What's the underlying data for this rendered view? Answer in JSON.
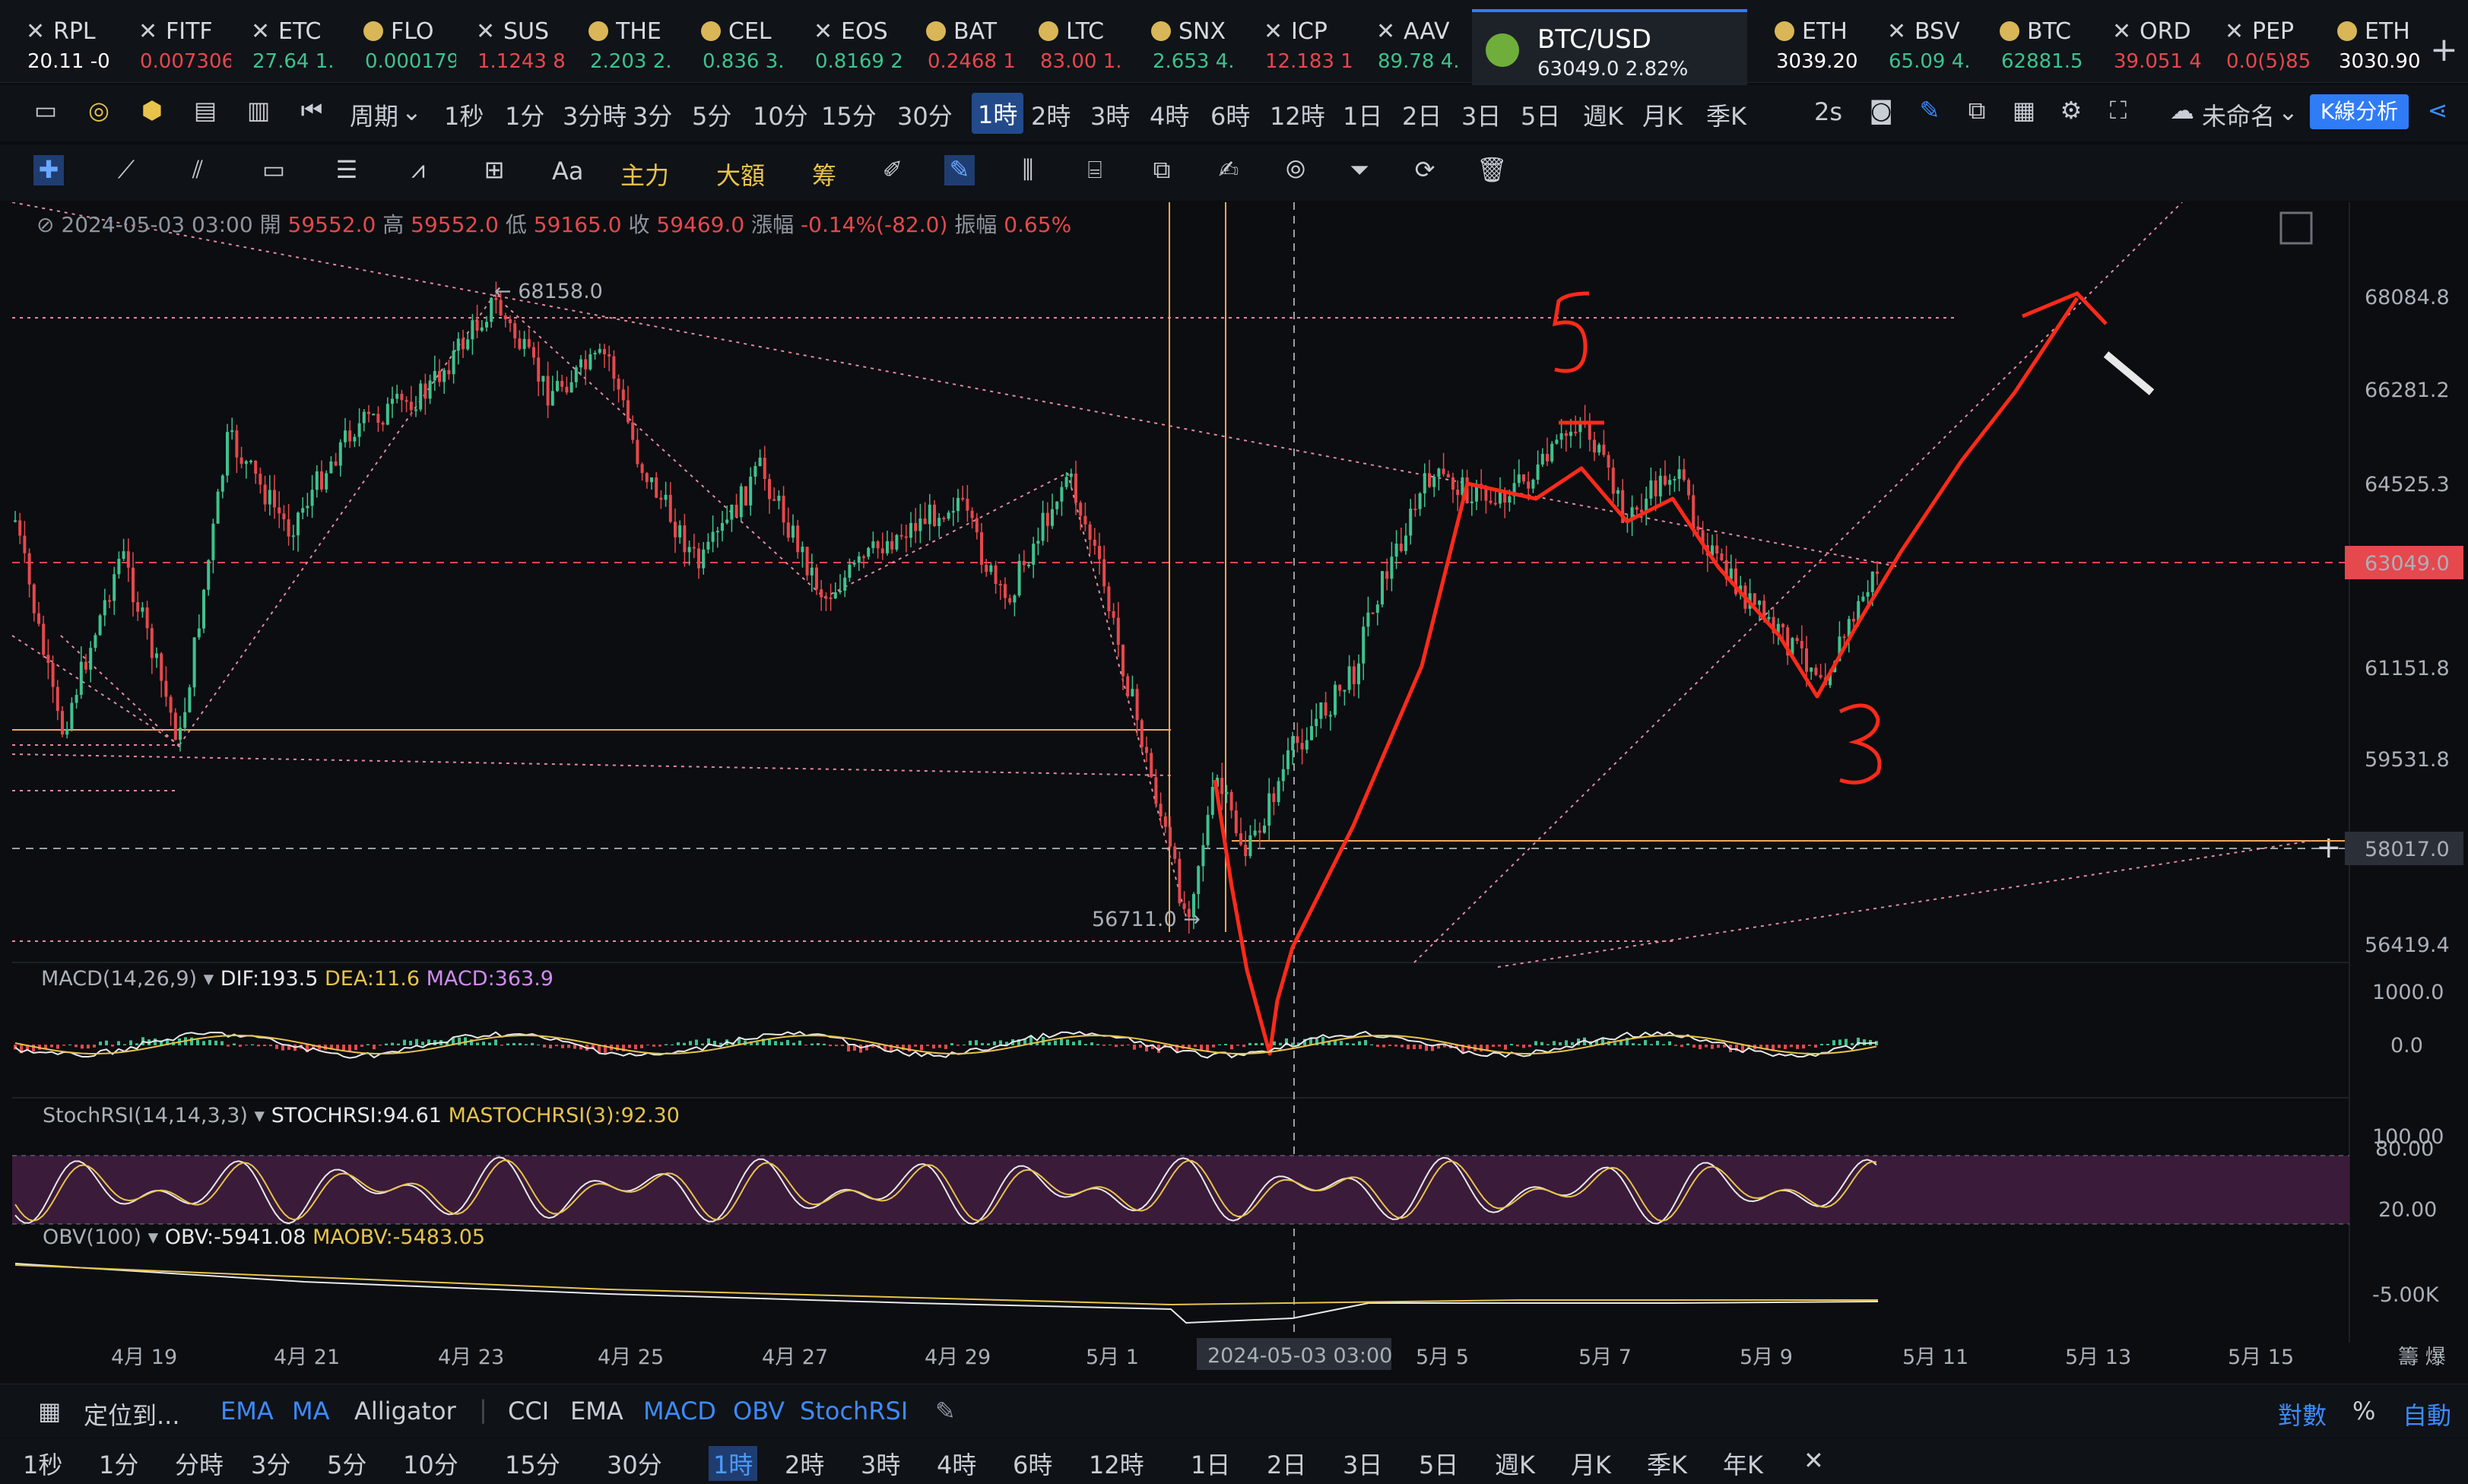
{
  "tickers": [
    {
      "name": "RPL",
      "value": "20.11 -0",
      "icon": "close-icon",
      "color": "#ffffff"
    },
    {
      "name": "FITF",
      "value": "0.007306",
      "icon": "close-icon",
      "color": "#e5484d"
    },
    {
      "name": "ETC",
      "value": "27.64 1.",
      "icon": "close-icon",
      "color": "#3ec28f"
    },
    {
      "name": "FLO",
      "value": "0.000179",
      "icon": "coin-icon",
      "color": "#3ec28f"
    },
    {
      "name": "SUS",
      "value": "1.1243 8",
      "icon": "close-icon",
      "color": "#e5484d"
    },
    {
      "name": "THE",
      "value": "2.203 2.",
      "icon": "coin-icon",
      "color": "#3ec28f"
    },
    {
      "name": "CEL",
      "value": "0.836 3.",
      "icon": "coin-icon",
      "color": "#3ec28f"
    },
    {
      "name": "EOS",
      "value": "0.8169 2",
      "icon": "close-icon",
      "color": "#3ec28f"
    },
    {
      "name": "BAT",
      "value": "0.2468 1",
      "icon": "coin-icon",
      "color": "#e5484d"
    },
    {
      "name": "LTC",
      "value": "83.00 1.",
      "icon": "coin-icon",
      "color": "#e5484d"
    },
    {
      "name": "SNX",
      "value": "2.653 4.",
      "icon": "coin-icon",
      "color": "#3ec28f"
    },
    {
      "name": "ICP",
      "value": "12.183 1",
      "icon": "close-icon",
      "color": "#e5484d"
    },
    {
      "name": "AAV",
      "value": "89.78 4.",
      "icon": "close-icon",
      "color": "#3ec28f"
    }
  ],
  "active_tab": {
    "name": "BTC/USD",
    "value": "63049.0  2.82%"
  },
  "tickers_right": [
    {
      "name": "ETH",
      "value": "3039.20",
      "icon": "coin-icon",
      "color": "#ffffff"
    },
    {
      "name": "BSV",
      "value": "65.09 4.",
      "icon": "close-icon",
      "color": "#3ec28f"
    },
    {
      "name": "BTC",
      "value": "62881.5",
      "icon": "coin-icon",
      "color": "#3ec28f"
    },
    {
      "name": "ORD",
      "value": "39.051 4",
      "icon": "close-icon",
      "color": "#e5484d"
    },
    {
      "name": "PEP",
      "value": "0.0(5)85",
      "icon": "close-icon",
      "color": "#e5484d"
    },
    {
      "name": "ETH",
      "value": "3030.90",
      "icon": "coin-icon",
      "color": "#ffffff"
    }
  ],
  "toolbar": {
    "period_label": "周期",
    "timeframes": [
      "1秒",
      "1分",
      "3分時",
      "3分",
      "5分",
      "10分",
      "15分",
      "30分",
      "1時",
      "2時",
      "3時",
      "4時",
      "6時",
      "12時",
      "1日",
      "2日",
      "3日",
      "5日",
      "週K",
      "月K",
      "季K"
    ],
    "active_timeframe": "1時",
    "refresh": "2s",
    "layout_name": "未命名",
    "kline_button": "K線分析"
  },
  "drawing_tools": {
    "text_tool": "Aa",
    "main_force": "主力",
    "big_amount": "大額",
    "chips": "筹"
  },
  "ohlc": {
    "date": "2024-05-03 03:00",
    "open_label": "開",
    "open": "59552.0",
    "high_label": "高",
    "high": "59552.0",
    "low_label": "低",
    "low": "59165.0",
    "close_label": "收",
    "close": "59469.0",
    "change_label": "漲幅",
    "change": "-0.14%(-82.0)",
    "amp_label": "振幅",
    "amp": "0.65%"
  },
  "price_axis": [
    "68084.8",
    "66281.2",
    "64525.3",
    "61151.8",
    "59531.8",
    "56419.4"
  ],
  "current_price": "63049.0",
  "crosshair_price": "58017.0",
  "price_annotations": {
    "high": "68158.0",
    "low": "56711.0"
  },
  "handwriting": {
    "wave5": "5",
    "wave3": "3"
  },
  "macd": {
    "name": "MACD(14,26,9)",
    "dif_label": "DIF:193.5",
    "dea_label": "DEA:11.6",
    "macd_label": "MACD:363.9",
    "axis": [
      "1000.0",
      "0.0"
    ]
  },
  "stochrsi": {
    "name": "StochRSI(14,14,3,3)",
    "k_label": "STOCHRSI:94.61",
    "d_label": "MASTOCHRSI(3):92.30",
    "axis": [
      "100.00",
      "80.00",
      "20.00"
    ]
  },
  "obv": {
    "name": "OBV(100)",
    "obv_label": "OBV:-5941.08",
    "ma_label": "MAOBV:-5483.05",
    "axis": [
      "-5.00K"
    ]
  },
  "date_axis": [
    "4月 19",
    "4月 21",
    "4月 23",
    "4月 25",
    "4月 27",
    "4月 29",
    "5月 1",
    "5月 5",
    "5月 7",
    "5月 9",
    "5月 11",
    "5月 13",
    "5月 15"
  ],
  "crosshair_date": "2024-05-03 03:00",
  "date_axis_right": "籌 爆",
  "bottom_indicators": {
    "locate": "定位到...",
    "items": [
      "EMA",
      "MA",
      "Alligator",
      "CCI",
      "EMA",
      "MACD",
      "OBV",
      "StochRSI"
    ],
    "scale": [
      "對數",
      "%",
      "自動"
    ]
  },
  "bottom_timeframes": [
    "1秒",
    "1分",
    "分時",
    "3分",
    "5分",
    "10分",
    "15分",
    "30分",
    "1時",
    "2時",
    "3時",
    "4時",
    "6時",
    "12時",
    "1日",
    "2日",
    "3日",
    "5日",
    "週K",
    "月K",
    "季K",
    "年K"
  ],
  "bottom_active_timeframe": "1時",
  "colors": {
    "up": "#3ec28f",
    "down": "#e5484d",
    "accent": "#2f7cf6",
    "gold": "#e7c34b",
    "drawing": "#ff2a1a",
    "orange_line": "#f2a65a"
  }
}
